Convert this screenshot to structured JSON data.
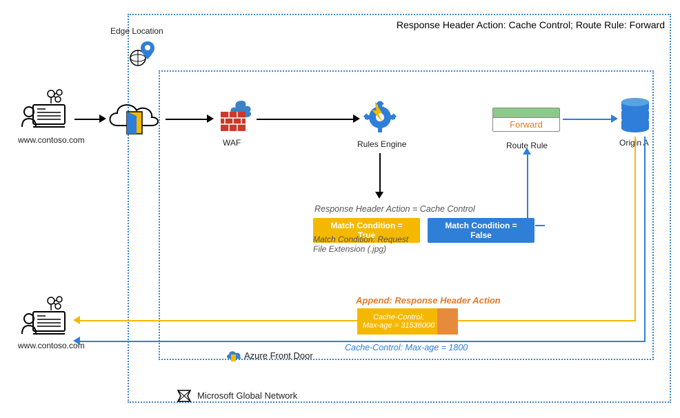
{
  "header": "Response Header Action: Cache Control; Route Rule: Forward",
  "edge_location": "Edge Location",
  "nodes": {
    "client_top": "www.contoso.com",
    "client_bottom": "www.contoso.com",
    "waf": "WAF",
    "rules_engine": "Rules Engine",
    "route_rule": "Route Rule",
    "forward": "Forward",
    "origin_a": "Origin A",
    "azure_front_door": "Azure Front Door",
    "microsoft_global_network": "Microsoft Global Network"
  },
  "rules": {
    "response_header_action": "Response Header Action = Cache Control",
    "match_true": "Match Condition = True",
    "match_false": "Match Condition = False",
    "match_condition_note": "Match Condition: Request File Extension (.jpg)"
  },
  "append": {
    "title": "Append: Response Header Action",
    "cache_control_line1": "Cache-Control:",
    "cache_control_line2": "Max-age = 31536000"
  },
  "return_blue": "Cache-Control: Max-age = 1800"
}
